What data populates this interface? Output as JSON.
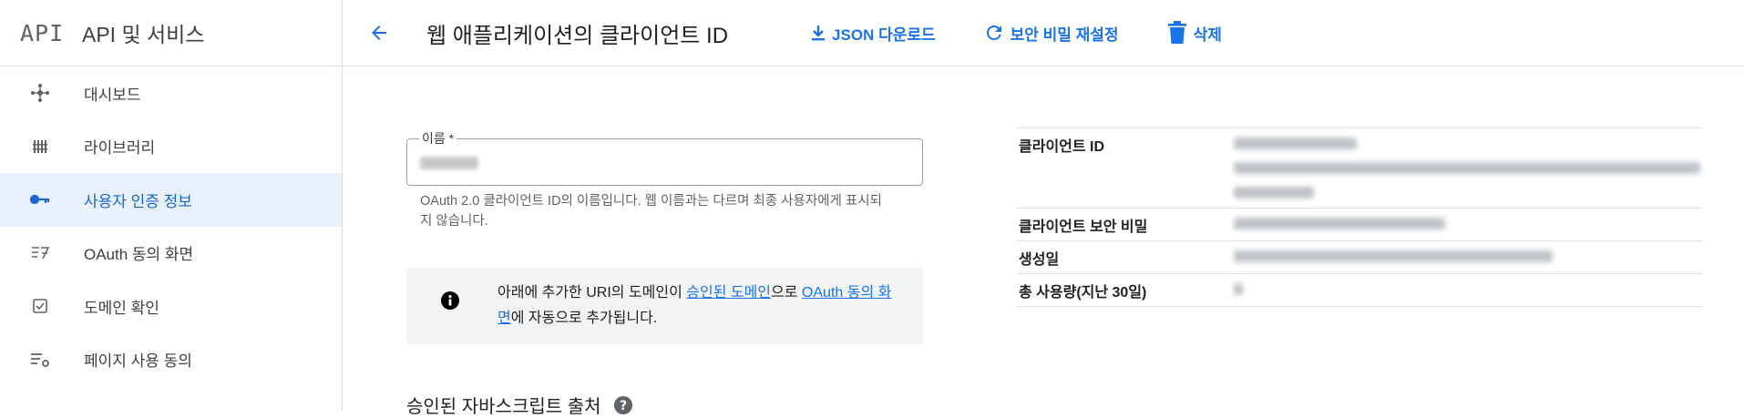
{
  "sidebar": {
    "logo": "API",
    "title": "API 및 서비스",
    "items": [
      {
        "label": "대시보드",
        "icon": "dashboard-icon",
        "active": false
      },
      {
        "label": "라이브러리",
        "icon": "library-icon",
        "active": false
      },
      {
        "label": "사용자 인증 정보",
        "icon": "key-icon",
        "active": true
      },
      {
        "label": "OAuth 동의 화면",
        "icon": "consent-screen-icon",
        "active": false
      },
      {
        "label": "도메인 확인",
        "icon": "checkbox-icon",
        "active": false
      },
      {
        "label": "페이지 사용 동의",
        "icon": "page-settings-icon",
        "active": false
      }
    ]
  },
  "header": {
    "title": "웹 애플리케이션의 클라이언트 ID",
    "actions": {
      "json_download": "JSON 다운로드",
      "reset_secret": "보안 비밀 재설정",
      "delete": "삭제"
    }
  },
  "form": {
    "name_label": "이름 *",
    "name_helper": "OAuth 2.0 클라이언트 ID의 이름입니다. 웹 이름과는 다르며 최종 사용자에게 표시되지 않습니다.",
    "info": {
      "text_before": "아래에 추가한 URI의 도메인이 ",
      "link1": "승인된 도메인",
      "text_middle": "으로 ",
      "link2": "OAuth 동의 화면",
      "text_after": "에 자동으로 추가됩니다."
    },
    "js_origins_heading": "승인된 자바스크립트 출처"
  },
  "details": {
    "client_id_label": "클라이언트 ID",
    "client_secret_label": "클라이언트 보안 비밀",
    "created_label": "생성일",
    "usage_label": "총 사용량(지난 30일)"
  },
  "colors": {
    "accent": "#1a73e8",
    "active_bg": "#e8f0fe",
    "divider": "#dadce0"
  }
}
